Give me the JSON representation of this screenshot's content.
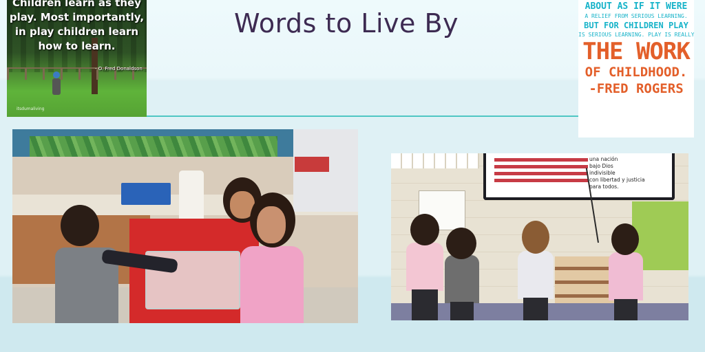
{
  "slide": {
    "title": "Words to Live By"
  },
  "left_poster": {
    "quote_lines": [
      "Children learn as they",
      "play. Most importantly,",
      "in play children learn",
      "how to learn."
    ],
    "attribution": "- O. Fred Donaldson",
    "tag": "itsdumaliving"
  },
  "right_poster": {
    "lines": [
      "ABOUT AS IF IT WERE",
      "A RELIEF FROM SERIOUS LEARNING.",
      "BUT FOR CHILDREN PLAY",
      "IS SERIOUS LEARNING. PLAY IS REALLY",
      "THE WORK",
      "OF CHILDHOOD.",
      "-FRED ROGERS"
    ],
    "colors": {
      "teal": "#17b3c9",
      "orange": "#e35f2a"
    }
  },
  "right_photo": {
    "pledge_lines": [
      "una nación",
      "bajo Dios",
      "indivisible",
      "con libertad y justicia",
      "para todos."
    ]
  },
  "colors": {
    "title": "#3d2b52",
    "divider": "#4ec6c3"
  }
}
